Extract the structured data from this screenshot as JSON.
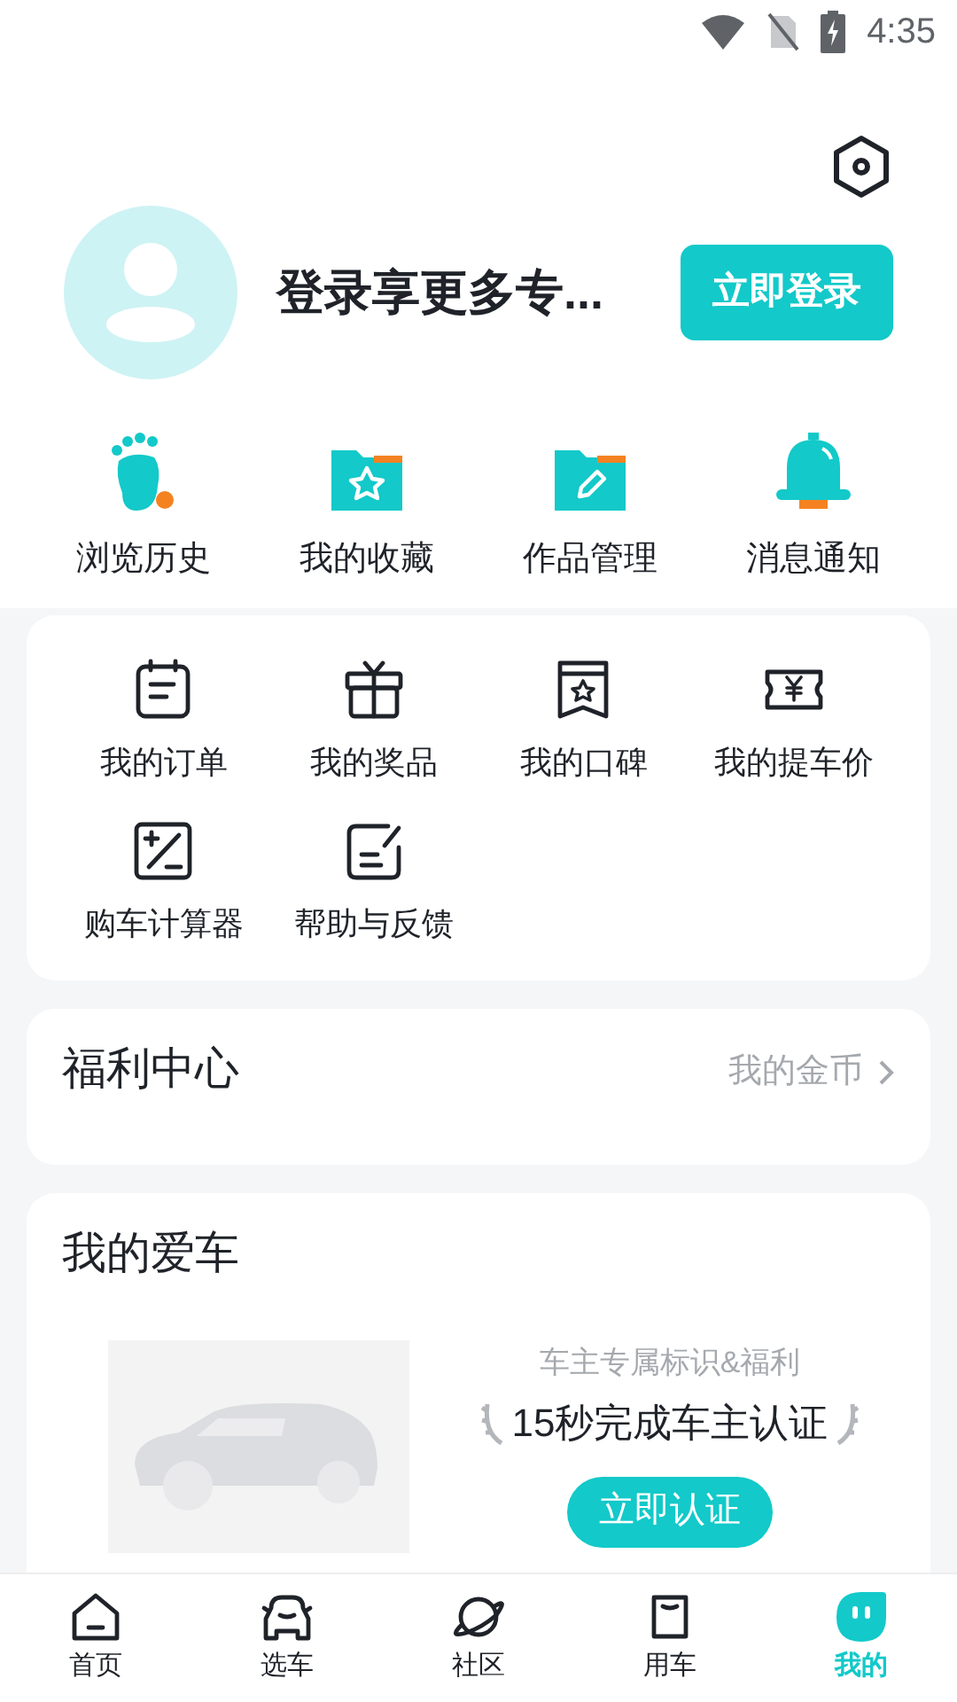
{
  "status_bar": {
    "time": "4:35"
  },
  "profile": {
    "name": "登录享更多专...",
    "login_button": "立即登录"
  },
  "quick_links": [
    {
      "label": "浏览历史"
    },
    {
      "label": "我的收藏"
    },
    {
      "label": "作品管理"
    },
    {
      "label": "消息通知"
    }
  ],
  "services": [
    {
      "label": "我的订单"
    },
    {
      "label": "我的奖品"
    },
    {
      "label": "我的口碑"
    },
    {
      "label": "我的提车价"
    },
    {
      "label": "购车计算器"
    },
    {
      "label": "帮助与反馈"
    }
  ],
  "welfare": {
    "title": "福利中心",
    "link": "我的金币"
  },
  "my_car": {
    "title": "我的爱车",
    "subtitle": "车主专属标识&福利",
    "headline": "15秒完成车主认证",
    "button": "立即认证"
  },
  "tab_bar": [
    {
      "label": "首页",
      "selected": false
    },
    {
      "label": "选车",
      "selected": false
    },
    {
      "label": "社区",
      "selected": false
    },
    {
      "label": "用车",
      "selected": false
    },
    {
      "label": "我的",
      "selected": true
    }
  ]
}
